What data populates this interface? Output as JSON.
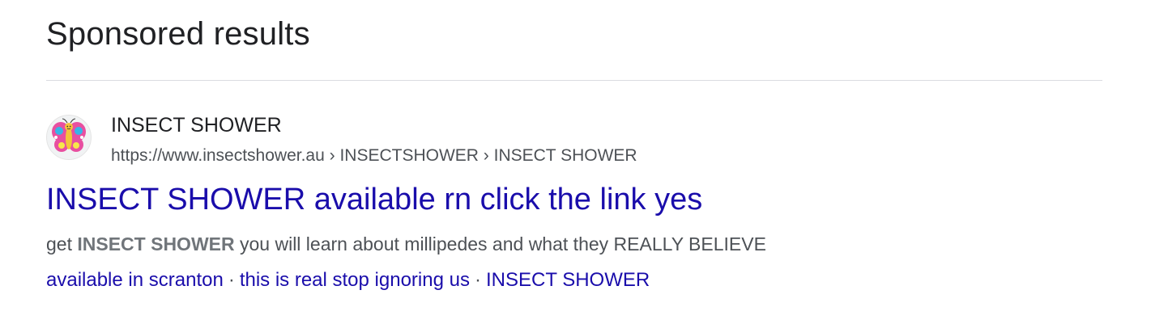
{
  "section": {
    "heading": "Sponsored results"
  },
  "result": {
    "favicon_icon": "butterfly-icon",
    "site_name": "INSECT SHOWER",
    "url": "https://www.insectshower.au › INSECTSHOWER › INSECT SHOWER",
    "title": "INSECT SHOWER available rn click the link yes",
    "snippet": {
      "prefix": "get ",
      "bold": "INSECT SHOWER",
      "suffix": " you will learn about millipedes and what they REALLY BELIEVE"
    },
    "sitelinks": [
      {
        "label": "available in scranton"
      },
      {
        "label": "this is real stop ignoring us"
      },
      {
        "label": "INSECT SHOWER"
      }
    ],
    "sitelink_separator": "·"
  },
  "colors": {
    "link": "#1a0dab",
    "text": "#202124",
    "muted": "#4d5156"
  }
}
